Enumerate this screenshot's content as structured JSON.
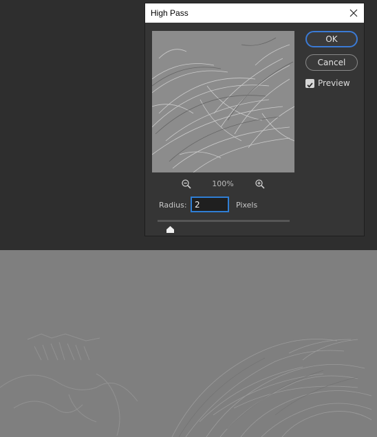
{
  "dialog": {
    "title": "High Pass",
    "close_icon": "close-icon",
    "zoom_level": "100%",
    "zoom_out_icon": "zoom-out-icon",
    "zoom_in_icon": "zoom-in-icon",
    "radius_label": "Radius:",
    "radius_value": "2",
    "radius_unit": "Pixels",
    "slider_level_fraction": 0.1,
    "ok_label": "OK",
    "cancel_label": "Cancel",
    "preview_label": "Preview",
    "preview_checked": true
  },
  "colors": {
    "workspace": "#2e2e2e",
    "dialog_bg": "#353535",
    "accent_blue": "#2f7fd6",
    "image_gray": "#7f7f7f"
  }
}
